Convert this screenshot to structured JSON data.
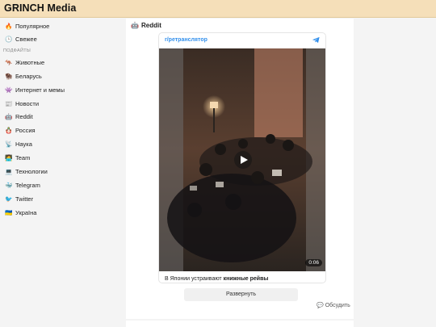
{
  "app": {
    "title": "GRINCH Media"
  },
  "sidebar": {
    "top_items": [
      {
        "icon": "fire-icon",
        "glyph": "🔥",
        "label": "Популярное"
      },
      {
        "icon": "clock-icon",
        "glyph": "🕒",
        "label": "Свежее"
      }
    ],
    "section_label": "ПОДФАЙТЫ",
    "items": [
      {
        "icon": "kangaroo-icon",
        "glyph": "🦘",
        "label": "Животные"
      },
      {
        "icon": "bison-icon",
        "glyph": "🦬",
        "label": "Беларусь"
      },
      {
        "icon": "alien-icon",
        "glyph": "👾",
        "label": "Интернет и мемы"
      },
      {
        "icon": "newspaper-icon",
        "glyph": "📰",
        "label": "Новости"
      },
      {
        "icon": "robot-icon",
        "glyph": "🤖",
        "label": "Reddit"
      },
      {
        "icon": "matryoshka-icon",
        "glyph": "🪆",
        "label": "Россия"
      },
      {
        "icon": "satellite-icon",
        "glyph": "📡",
        "label": "Наука"
      },
      {
        "icon": "technologist-icon",
        "glyph": "🧑‍💻",
        "label": "Team"
      },
      {
        "icon": "laptop-icon",
        "glyph": "💻",
        "label": "Технологии"
      },
      {
        "icon": "whale-icon",
        "glyph": "🐳",
        "label": "Telegram"
      },
      {
        "icon": "bird-icon",
        "glyph": "🐦",
        "label": "Twitter"
      },
      {
        "icon": "ukraine-flag-icon",
        "glyph": "🇺🇦",
        "label": "Україна"
      }
    ]
  },
  "feed": {
    "title": "Reddit",
    "title_glyph": "🤖",
    "post": {
      "source": "r/ретранслятор",
      "source_icon": "telegram-icon",
      "duration": "0:06",
      "caption_prefix": "В Японии устраивают ",
      "caption_bold": "книжные рейвы",
      "expand_label": "Развернуть",
      "discuss_label": "Обсудить",
      "discuss_glyph": "💬"
    }
  },
  "colors": {
    "header_bg": "#f5dfb9",
    "link": "#3390ec"
  }
}
